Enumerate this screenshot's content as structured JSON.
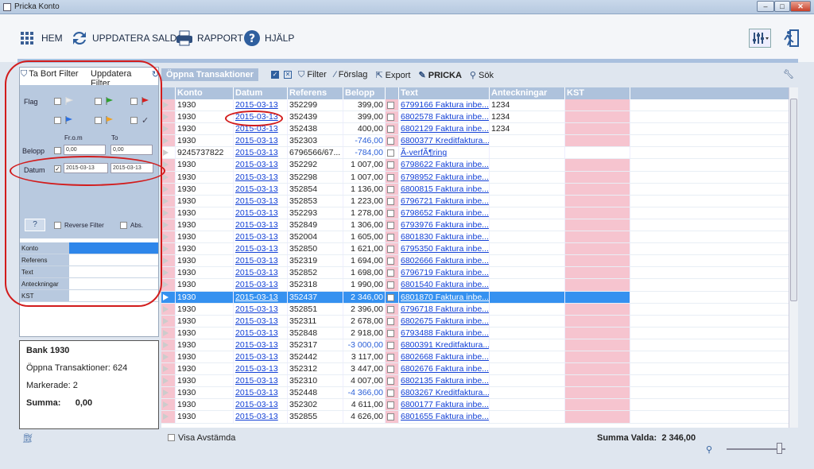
{
  "window": {
    "title": "Pricka Konto"
  },
  "toolbar": {
    "home": "HEM",
    "update": "UPPDATERA SALDO",
    "report": "RAPPORT",
    "help": "HJÄLP"
  },
  "filter": {
    "remove": "Ta Bort Filter",
    "update": "Uppdatera Filter",
    "flag_label": "Flag",
    "from_label": "Fr.o.m",
    "to_label": "To",
    "belopp_label": "Belopp",
    "belopp_from": "0,00",
    "belopp_to": "0,00",
    "datum_label": "Datum",
    "datum_from": "2015-03-13",
    "datum_to": "2015-03-13",
    "help_btn": "?",
    "reverse": "Reverse Filter",
    "abs": "Abs.",
    "fields": [
      "Konto",
      "Referens",
      "Text",
      "Anteckningar",
      "KST"
    ]
  },
  "info": {
    "bank": "Bank 1930",
    "open_label": "Öppna Transaktioner:",
    "open_count": "624",
    "marked_label": "Markerade:",
    "marked_count": "2",
    "sum_label": "Summa:",
    "sum_value": "0,00"
  },
  "gridtoolbar": {
    "tab": "Öppna Transaktioner",
    "filter": "Filter",
    "suggest": "Förslag",
    "export": "Export",
    "pricka": "PRICKA",
    "search": "Sök"
  },
  "columns": [
    "Konto",
    "Datum",
    "Referens",
    "Belopp",
    "",
    "Text",
    "Anteckningar",
    "KST"
  ],
  "rows": [
    [
      "1930",
      "2015-03-13",
      "352299",
      "399,00",
      "6799166 Faktura inbe...",
      "1234"
    ],
    [
      "1930",
      "2015-03-13",
      "352439",
      "399,00",
      "6802578 Faktura inbe...",
      "1234"
    ],
    [
      "1930",
      "2015-03-13",
      "352438",
      "400,00",
      "6802129 Faktura inbe...",
      "1234"
    ],
    [
      "1930",
      "2015-03-13",
      "352303",
      "-746,00",
      "6800377 Kreditfaktura...",
      ""
    ],
    [
      "9245737822",
      "2015-03-13",
      "6796566/67...",
      "-784,00",
      "Ã-verfÃ¶ring",
      ""
    ],
    [
      "1930",
      "2015-03-13",
      "352292",
      "1 007,00",
      "6798622 Faktura inbe...",
      ""
    ],
    [
      "1930",
      "2015-03-13",
      "352298",
      "1 007,00",
      "6798952 Faktura inbe...",
      ""
    ],
    [
      "1930",
      "2015-03-13",
      "352854",
      "1 136,00",
      "6800815 Faktura inbe...",
      ""
    ],
    [
      "1930",
      "2015-03-13",
      "352853",
      "1 223,00",
      "6796721 Faktura inbe...",
      ""
    ],
    [
      "1930",
      "2015-03-13",
      "352293",
      "1 278,00",
      "6798652 Faktura inbe...",
      ""
    ],
    [
      "1930",
      "2015-03-13",
      "352849",
      "1 306,00",
      "6793976 Faktura inbe...",
      ""
    ],
    [
      "1930",
      "2015-03-13",
      "352004",
      "1 605,00",
      "6801830 Faktura inbe...",
      ""
    ],
    [
      "1930",
      "2015-03-13",
      "352850",
      "1 621,00",
      "6795350 Faktura inbe...",
      ""
    ],
    [
      "1930",
      "2015-03-13",
      "352319",
      "1 694,00",
      "6802666 Faktura inbe...",
      ""
    ],
    [
      "1930",
      "2015-03-13",
      "352852",
      "1 698,00",
      "6796719 Faktura inbe...",
      ""
    ],
    [
      "1930",
      "2015-03-13",
      "352318",
      "1 990,00",
      "6801540 Faktura inbe...",
      ""
    ],
    [
      "1930",
      "2015-03-13",
      "352437",
      "2 346,00",
      "6801870 Faktura inbe...",
      ""
    ],
    [
      "1930",
      "2015-03-13",
      "352851",
      "2 396,00",
      "6796718 Faktura inbe...",
      ""
    ],
    [
      "1930",
      "2015-03-13",
      "352311",
      "2 678,00",
      "6802675 Faktura inbe...",
      ""
    ],
    [
      "1930",
      "2015-03-13",
      "352848",
      "2 918,00",
      "6793488 Faktura inbe...",
      ""
    ],
    [
      "1930",
      "2015-03-13",
      "352317",
      "-3 000,00",
      "6800391 Kreditfaktura...",
      ""
    ],
    [
      "1930",
      "2015-03-13",
      "352442",
      "3 117,00",
      "6802668 Faktura inbe...",
      ""
    ],
    [
      "1930",
      "2015-03-13",
      "352312",
      "3 447,00",
      "6802676 Faktura inbe...",
      ""
    ],
    [
      "1930",
      "2015-03-13",
      "352310",
      "4 007,00",
      "6802135 Faktura inbe...",
      ""
    ],
    [
      "1930",
      "2015-03-13",
      "352448",
      "-4 366,00",
      "6803267 Kreditfaktura...",
      ""
    ],
    [
      "1930",
      "2015-03-13",
      "352302",
      "4 611,00",
      "6800177 Faktura inbe...",
      ""
    ],
    [
      "1930",
      "2015-03-13",
      "352855",
      "4 626,00",
      "6801655 Faktura inbe...",
      ""
    ]
  ],
  "selected_row": 16,
  "white_row": 4,
  "bottom": {
    "show_reconciled": "Visa Avstämda",
    "sum_label": "Summa Valda:",
    "sum_value": "2 346,00"
  }
}
